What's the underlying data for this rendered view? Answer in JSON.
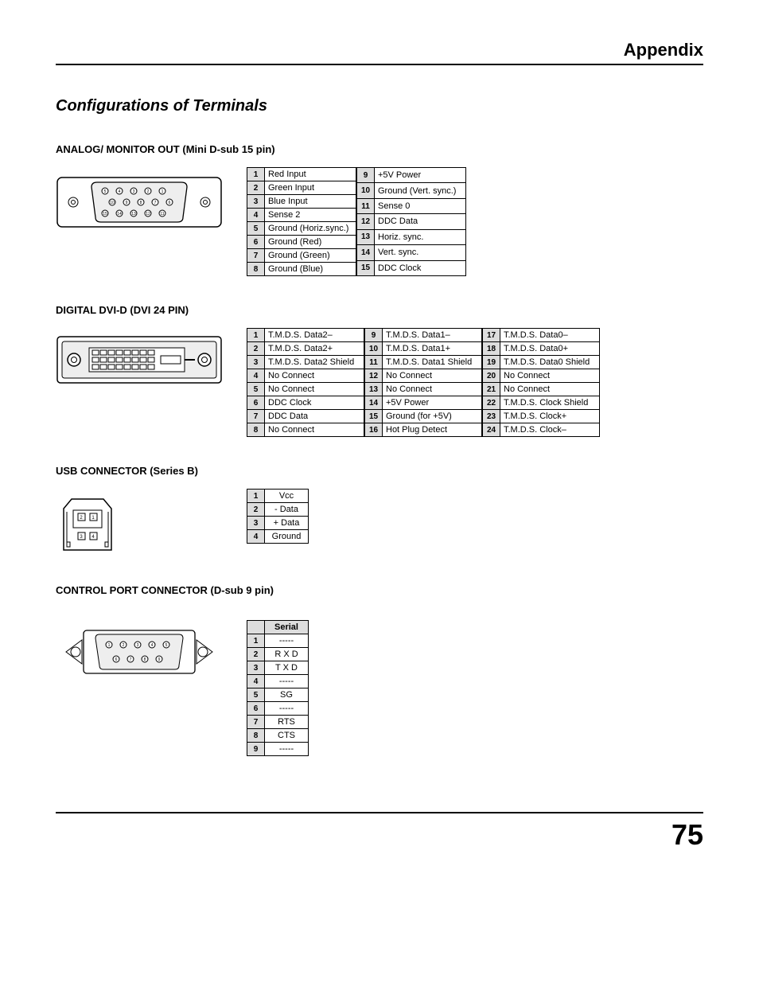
{
  "header": "Appendix",
  "main_title": "Configurations of Terminals",
  "page_number": "75",
  "sections": {
    "analog": {
      "title": "ANALOG/ MONITOR OUT (Mini D-sub 15 pin)",
      "pins": [
        {
          "n": "1",
          "s": "Red Input"
        },
        {
          "n": "2",
          "s": "Green Input"
        },
        {
          "n": "3",
          "s": "Blue Input"
        },
        {
          "n": "4",
          "s": "Sense 2"
        },
        {
          "n": "5",
          "s": "Ground (Horiz.sync.)"
        },
        {
          "n": "6",
          "s": "Ground (Red)"
        },
        {
          "n": "7",
          "s": "Ground (Green)"
        },
        {
          "n": "8",
          "s": "Ground (Blue)"
        },
        {
          "n": "9",
          "s": "+5V Power"
        },
        {
          "n": "10",
          "s": "Ground (Vert. sync.)"
        },
        {
          "n": "11",
          "s": "Sense 0"
        },
        {
          "n": "12",
          "s": "DDC Data"
        },
        {
          "n": "13",
          "s": "Horiz. sync."
        },
        {
          "n": "14",
          "s": "Vert. sync."
        },
        {
          "n": "15",
          "s": "DDC Clock"
        }
      ]
    },
    "dvi": {
      "title": "DIGITAL DVI-D (DVI 24 PIN)",
      "pins": [
        {
          "n": "1",
          "s": "T.M.D.S. Data2–"
        },
        {
          "n": "2",
          "s": "T.M.D.S. Data2+"
        },
        {
          "n": "3",
          "s": "T.M.D.S. Data2 Shield"
        },
        {
          "n": "4",
          "s": "No Connect"
        },
        {
          "n": "5",
          "s": "No Connect"
        },
        {
          "n": "6",
          "s": "DDC Clock"
        },
        {
          "n": "7",
          "s": "DDC Data"
        },
        {
          "n": "8",
          "s": "No Connect"
        },
        {
          "n": "9",
          "s": "T.M.D.S. Data1–"
        },
        {
          "n": "10",
          "s": "T.M.D.S. Data1+"
        },
        {
          "n": "11",
          "s": "T.M.D.S. Data1 Shield"
        },
        {
          "n": "12",
          "s": "No Connect"
        },
        {
          "n": "13",
          "s": "No Connect"
        },
        {
          "n": "14",
          "s": "+5V Power"
        },
        {
          "n": "15",
          "s": "Ground (for +5V)"
        },
        {
          "n": "16",
          "s": "Hot Plug Detect"
        },
        {
          "n": "17",
          "s": "T.M.D.S. Data0–"
        },
        {
          "n": "18",
          "s": "T.M.D.S. Data0+"
        },
        {
          "n": "19",
          "s": "T.M.D.S. Data0 Shield"
        },
        {
          "n": "20",
          "s": "No Connect"
        },
        {
          "n": "21",
          "s": "No Connect"
        },
        {
          "n": "22",
          "s": "T.M.D.S. Clock Shield"
        },
        {
          "n": "23",
          "s": "T.M.D.S. Clock+"
        },
        {
          "n": "24",
          "s": "T.M.D.S. Clock–"
        }
      ]
    },
    "usb": {
      "title": "USB CONNECTOR (Series B)",
      "pins": [
        {
          "n": "1",
          "s": "Vcc"
        },
        {
          "n": "2",
          "s": "- Data"
        },
        {
          "n": "3",
          "s": "+ Data"
        },
        {
          "n": "4",
          "s": "Ground"
        }
      ]
    },
    "control": {
      "title": "CONTROL PORT CONNECTOR (D-sub 9 pin)",
      "header": "Serial",
      "pins": [
        {
          "n": "1",
          "s": "-----"
        },
        {
          "n": "2",
          "s": "R X D"
        },
        {
          "n": "3",
          "s": "T X D"
        },
        {
          "n": "4",
          "s": "-----"
        },
        {
          "n": "5",
          "s": "SG"
        },
        {
          "n": "6",
          "s": "-----"
        },
        {
          "n": "7",
          "s": "RTS"
        },
        {
          "n": "8",
          "s": "CTS"
        },
        {
          "n": "9",
          "s": "-----"
        }
      ]
    }
  }
}
